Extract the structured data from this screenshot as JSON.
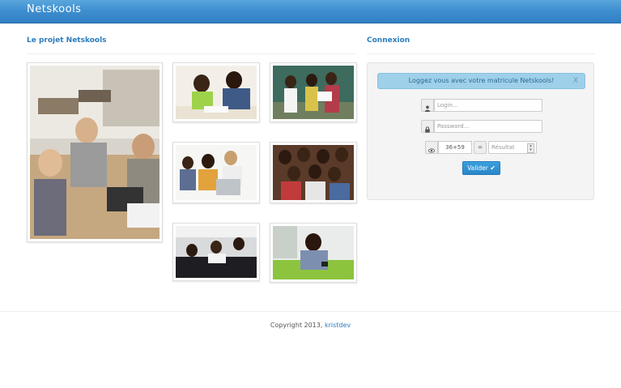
{
  "header": {
    "brand": "Netskools"
  },
  "project": {
    "title": "Le projet Netskools"
  },
  "login": {
    "title": "Connexion",
    "alert_text": "Loggez vous avec votre matricule Netskools!",
    "alert_close": "X",
    "login_placeholder": "Login...",
    "password_placeholder": "Password...",
    "captcha_question": "36+59",
    "equals": "=",
    "result_placeholder": "Résultat",
    "submit_label": "Valider",
    "submit_icon": "check-icon",
    "colors": {
      "button": "#2a86c8",
      "alert": "#9fd0ea"
    }
  },
  "gallery": {
    "images": [
      "classroom-meeting-photo",
      "students-reading-photo",
      "classroom-presentation-photo",
      "students-laptop-photo",
      "student-group-photo",
      "conference-room-photo",
      "student-phone-lawn-photo"
    ]
  },
  "footer": {
    "copyright": "Copyright 2013,",
    "author": "kristdev"
  },
  "theme": {
    "brand_blue": "#3f8fd0",
    "link_blue": "#2a7bbd"
  }
}
